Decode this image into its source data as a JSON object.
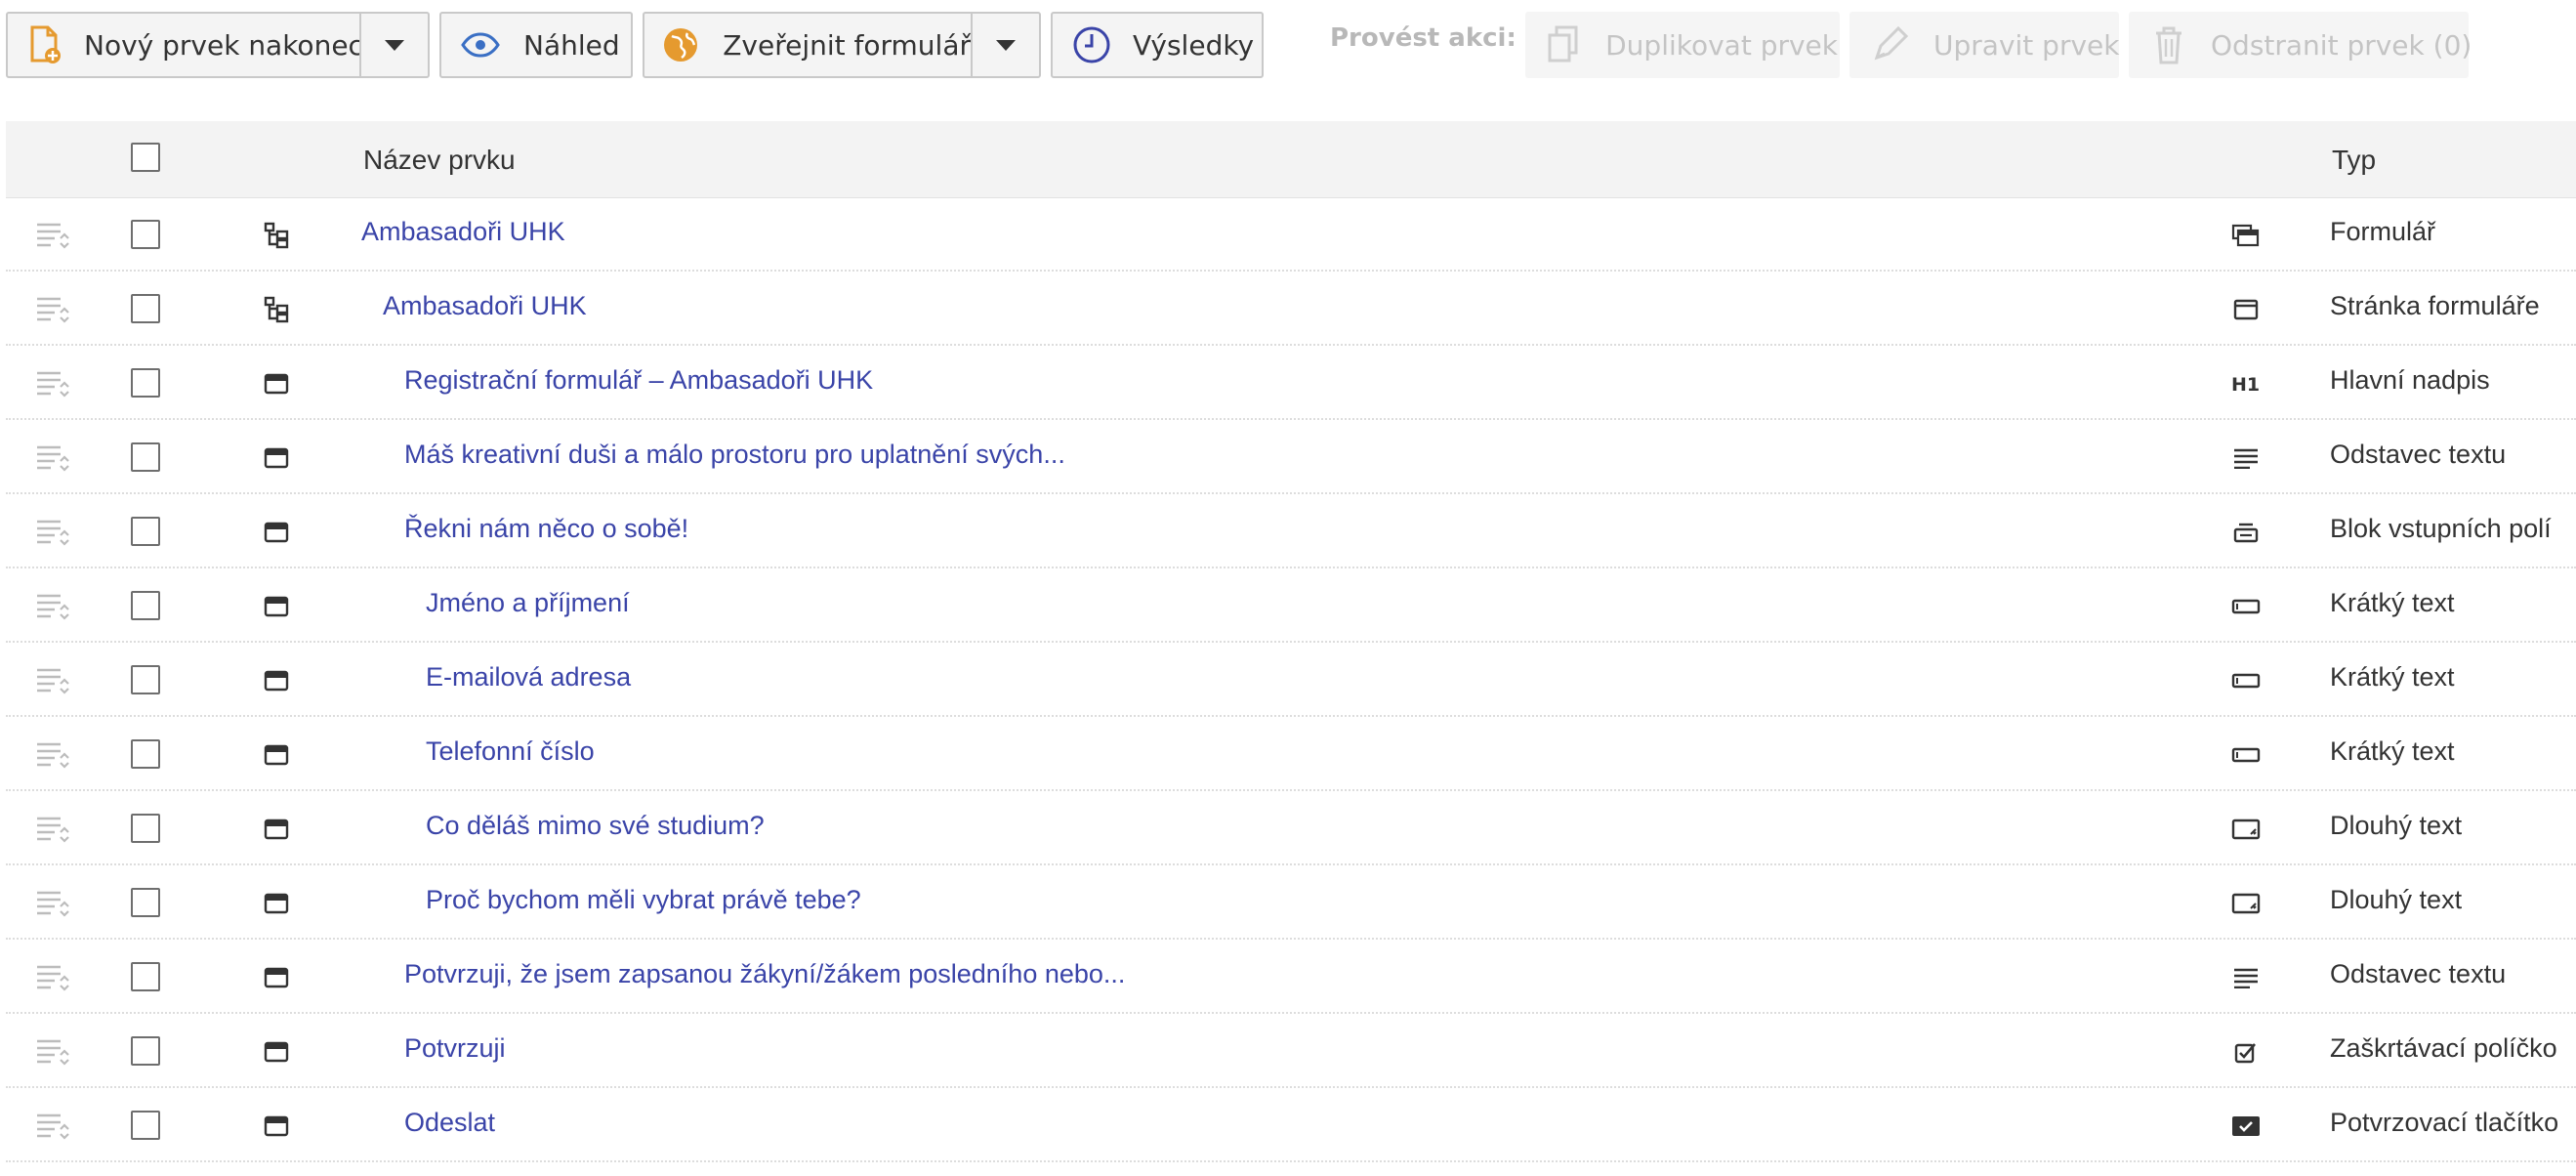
{
  "toolbar": {
    "new_item": "Nový prvek nakonec",
    "preview": "Náhled",
    "publish": "Zveřejnit formulář",
    "results": "Výsledky",
    "actions_label": "Provést akci:",
    "duplicate": "Duplikovat prvek",
    "edit": "Upravit prvek",
    "delete": "Odstranit prvek (0)"
  },
  "table": {
    "col_name": "Název prvku",
    "col_type": "Typ",
    "rows": [
      {
        "name": "Ambasadoři UHK",
        "type": "Formulář",
        "type_icon": "form-icon",
        "tree_icon": "tree-icon"
      },
      {
        "name": "Ambasadoři UHK",
        "type": "Stránka formuláře",
        "type_icon": "page-icon",
        "tree_icon": "tree-icon"
      },
      {
        "name": "Registrační formulář – Ambasadoři UHK",
        "type": "Hlavní nadpis",
        "type_icon": "heading-icon",
        "tree_icon": "window-icon"
      },
      {
        "name": "Máš kreativní duši a málo prostoru pro uplatnění svých...",
        "type": "Odstavec textu",
        "type_icon": "paragraph-icon",
        "tree_icon": "window-icon"
      },
      {
        "name": "Řekni nám něco o sobě!",
        "type": "Blok vstupních polí",
        "type_icon": "field-block-icon",
        "tree_icon": "window-icon"
      },
      {
        "name": "Jméno a příjmení",
        "type": "Krátký text",
        "type_icon": "short-text-icon",
        "tree_icon": "window-icon"
      },
      {
        "name": "E-mailová adresa",
        "type": "Krátký text",
        "type_icon": "short-text-icon",
        "tree_icon": "window-icon"
      },
      {
        "name": "Telefonní číslo",
        "type": "Krátký text",
        "type_icon": "short-text-icon",
        "tree_icon": "window-icon"
      },
      {
        "name": "Co děláš mimo své studium?",
        "type": "Dlouhý text",
        "type_icon": "long-text-icon",
        "tree_icon": "window-icon"
      },
      {
        "name": "Proč bychom měli vybrat právě tebe?",
        "type": "Dlouhý text",
        "type_icon": "long-text-icon",
        "tree_icon": "window-icon"
      },
      {
        "name": "Potvrzuji, že jsem zapsanou žákyní/žákem posledního nebo...",
        "type": "Odstavec textu",
        "type_icon": "paragraph-icon",
        "tree_icon": "window-icon"
      },
      {
        "name": "Potvrzuji",
        "type": "Zaškrtávací políčko",
        "type_icon": "checkbox-icon",
        "tree_icon": "window-icon"
      },
      {
        "name": "Odeslat",
        "type": "Potvrzovací tlačítko",
        "type_icon": "submit-button-icon",
        "tree_icon": "window-icon"
      }
    ]
  },
  "colors": {
    "link": "#3a44a8",
    "header_bg": "#f3f3f3",
    "button_bg": "#f4f4f4",
    "disabled_text": "#c4c4c4"
  }
}
